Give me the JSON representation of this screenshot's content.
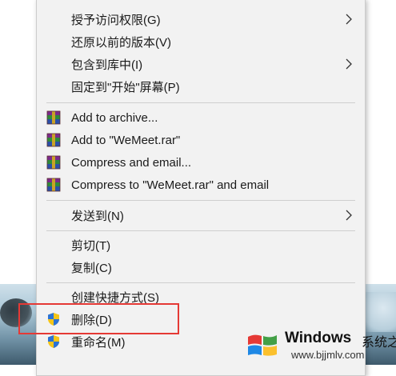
{
  "menu": {
    "items": [
      {
        "label": "授予访问权限(G)",
        "has_submenu": true,
        "icon": null
      },
      {
        "label": "还原以前的版本(V)",
        "has_submenu": false,
        "icon": null
      },
      {
        "label": "包含到库中(I)",
        "has_submenu": true,
        "icon": null
      },
      {
        "label": "固定到\"开始\"屏幕(P)",
        "has_submenu": false,
        "icon": null
      },
      {
        "label": "Add to archive...",
        "has_submenu": false,
        "icon": "winrar-icon"
      },
      {
        "label": "Add to \"WeMeet.rar\"",
        "has_submenu": false,
        "icon": "winrar-icon"
      },
      {
        "label": "Compress and email...",
        "has_submenu": false,
        "icon": "winrar-icon"
      },
      {
        "label": "Compress to \"WeMeet.rar\" and email",
        "has_submenu": false,
        "icon": "winrar-icon"
      },
      {
        "label": "发送到(N)",
        "has_submenu": true,
        "icon": null
      },
      {
        "label": "剪切(T)",
        "has_submenu": false,
        "icon": null
      },
      {
        "label": "复制(C)",
        "has_submenu": false,
        "icon": null
      },
      {
        "label": "创建快捷方式(S)",
        "has_submenu": false,
        "icon": null
      },
      {
        "label": "删除(D)",
        "has_submenu": false,
        "icon": "uac-shield-icon"
      },
      {
        "label": "重命名(M)",
        "has_submenu": false,
        "icon": "uac-shield-icon"
      }
    ]
  },
  "highlight": {
    "target": "删除(D)",
    "color": "#e53935"
  },
  "watermark": {
    "brand": "Windows",
    "sub": "系统之家",
    "url": "www.bjjmlv.com"
  },
  "colors": {
    "menu_bg": "#f2f2f2",
    "separator": "#cfcfcf",
    "highlight": "#e53935"
  }
}
